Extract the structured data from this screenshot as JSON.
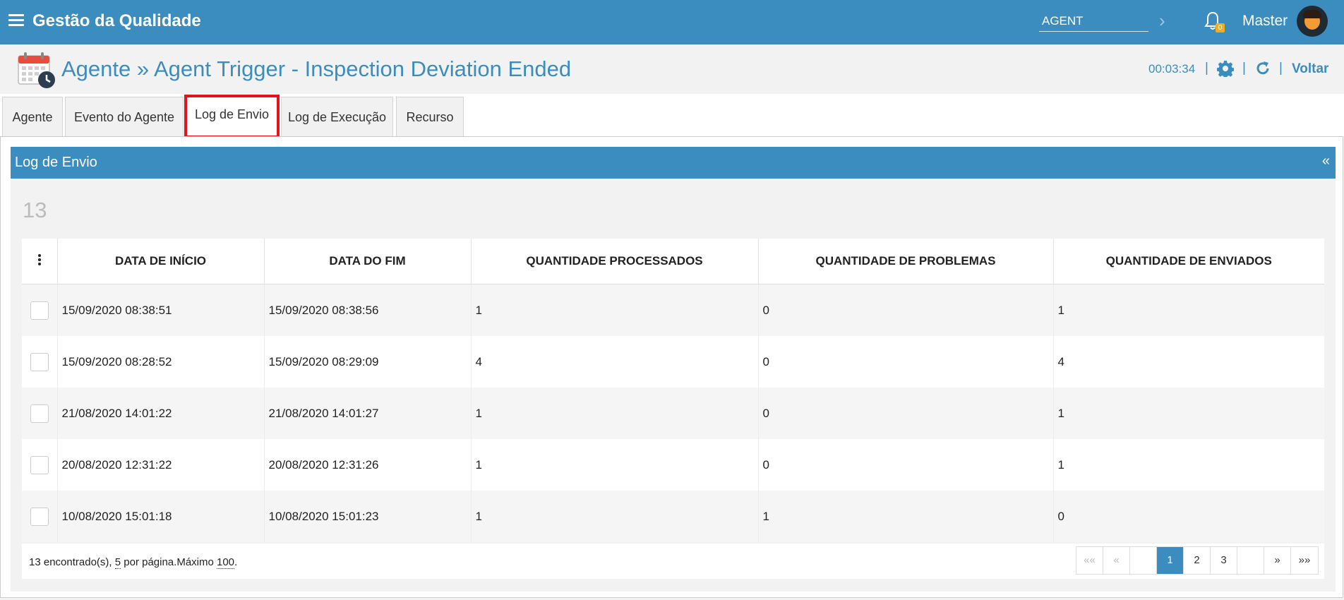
{
  "topbar": {
    "app_title": "Gestão da Qualidade",
    "search_value": "AGENT",
    "notification_count": "0",
    "user_name": "Master"
  },
  "header": {
    "title": "Agente » Agent Trigger - Inspection Deviation Ended",
    "timer": "00:03:34",
    "back_label": "Voltar"
  },
  "tabs": [
    {
      "label": "Agente"
    },
    {
      "label": "Evento do Agente"
    },
    {
      "label": "Log de Envio"
    },
    {
      "label": "Log de Execução"
    },
    {
      "label": "Recurso"
    }
  ],
  "panel": {
    "title": "Log de Envio",
    "collapse_glyph": "«",
    "count": "13"
  },
  "table": {
    "headers": [
      "DATA DE INÍCIO",
      "DATA DO FIM",
      "QUANTIDADE PROCESSADOS",
      "QUANTIDADE DE PROBLEMAS",
      "QUANTIDADE DE ENVIADOS"
    ],
    "rows": [
      [
        "15/09/2020 08:38:51",
        "15/09/2020 08:38:56",
        "1",
        "0",
        "1"
      ],
      [
        "15/09/2020 08:28:52",
        "15/09/2020 08:29:09",
        "4",
        "0",
        "4"
      ],
      [
        "21/08/2020 14:01:22",
        "21/08/2020 14:01:27",
        "1",
        "0",
        "1"
      ],
      [
        "20/08/2020 12:31:22",
        "20/08/2020 12:31:26",
        "1",
        "0",
        "1"
      ],
      [
        "10/08/2020 15:01:18",
        "10/08/2020 15:01:23",
        "1",
        "1",
        "0"
      ]
    ]
  },
  "footer": {
    "found": "13",
    "found_suffix": " encontrado(s), ",
    "per_page": "5",
    "per_page_suffix": " por página.Máximo ",
    "max": "100",
    "end": "."
  },
  "pagination": {
    "first": "««",
    "prev": "«",
    "pages": [
      "1",
      "2",
      "3"
    ],
    "next": "»",
    "last": "»»"
  }
}
